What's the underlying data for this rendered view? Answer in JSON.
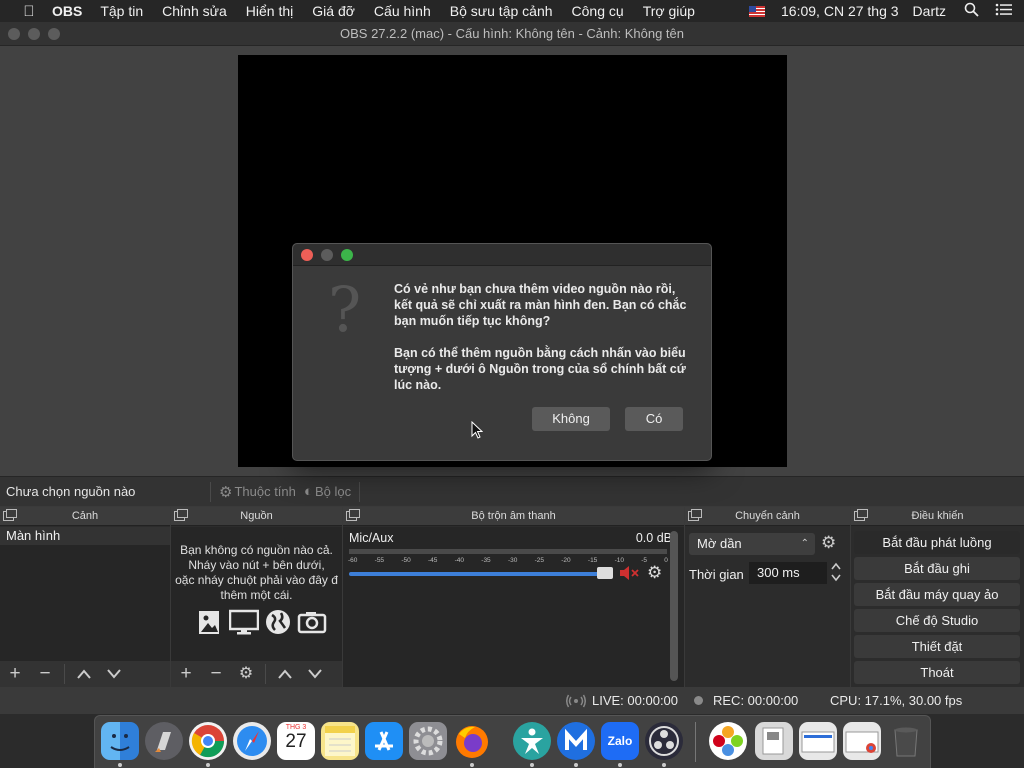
{
  "menubar": {
    "app_name": "OBS",
    "items": [
      "Tập tin",
      "Chỉnh sửa",
      "Hiển thị",
      "Giá đỡ",
      "Cấu hình",
      "Bộ sưu tập cảnh",
      "Công cụ",
      "Trợ giúp"
    ],
    "clock": "16:09, CN 27 thg 3",
    "user": "Dartz"
  },
  "window": {
    "title": "OBS 27.2.2 (mac) - Cấu hình: Không tên - Cảnh: Không tên"
  },
  "dialog": {
    "message_1": "Có vẻ như bạn chưa thêm video nguồn nào rồi, kết quả sẽ chỉ xuất ra màn hình đen. Bạn có chắc bạn muốn tiếp tục không?",
    "message_2": "Bạn có thể thêm nguồn bằng cách nhấn vào biểu tượng + dưới ô Nguồn trong của sổ chính bất cứ lúc nào.",
    "no_label": "Không",
    "yes_label": "Có"
  },
  "source_toolbar": {
    "no_source": "Chưa chọn nguồn nào",
    "properties": "Thuộc tính",
    "filters": "Bộ lọc"
  },
  "scenes": {
    "title": "Cảnh",
    "items": [
      "Màn hình"
    ]
  },
  "sources": {
    "title": "Nguồn",
    "hint_lines": [
      "Bạn không có nguồn nào cả.",
      "Nháy vào nút + bên dưới,",
      "oặc nháy chuột phải vào đây đ",
      "thêm một cái."
    ]
  },
  "mixer": {
    "title": "Bộ trộn âm thanh",
    "channel": "Mic/Aux",
    "level": "0.0 dB",
    "ticks": [
      "-60",
      "-55",
      "-50",
      "-45",
      "-40",
      "-35",
      "-30",
      "-25",
      "-20",
      "-15",
      "-10",
      "-5",
      "0"
    ],
    "fader_fraction": 1.0
  },
  "transitions": {
    "title": "Chuyển cảnh",
    "selected": "Mờ dần",
    "duration_label": "Thời gian",
    "duration_value": "300 ms"
  },
  "controls": {
    "title": "Điều khiển",
    "buttons": [
      "Bắt đầu phát luồng",
      "Bắt đầu ghi",
      "Bắt đầu máy quay ảo",
      "Chế độ Studio",
      "Thiết đặt",
      "Thoát"
    ]
  },
  "status": {
    "live": "LIVE: 00:00:00",
    "rec": "REC: 00:00:00",
    "cpu": "CPU: 17.1%, 30.00 fps"
  },
  "dock_apps": {
    "calendar_month": "THG 3",
    "calendar_day": "27",
    "zalo": "Zalo",
    "colors": {
      "finder": "#4a8fe0",
      "launchpad": "#6b6b6b",
      "chrome": "#e7e7e7",
      "safari": "#2d8cf0",
      "calendar": "#ffffff",
      "notes": "#f6e58d",
      "appstore": "#1f8ff5",
      "settings": "#8e8e93",
      "firefox": "#e66000",
      "teams": "#2aa3a0",
      "malwarebytes": "#1f6fe0",
      "zalo": "#1e6cf5",
      "obs": "#2b2b3a",
      "photos": "#ffffff",
      "trash": "#9a9a9a"
    }
  }
}
